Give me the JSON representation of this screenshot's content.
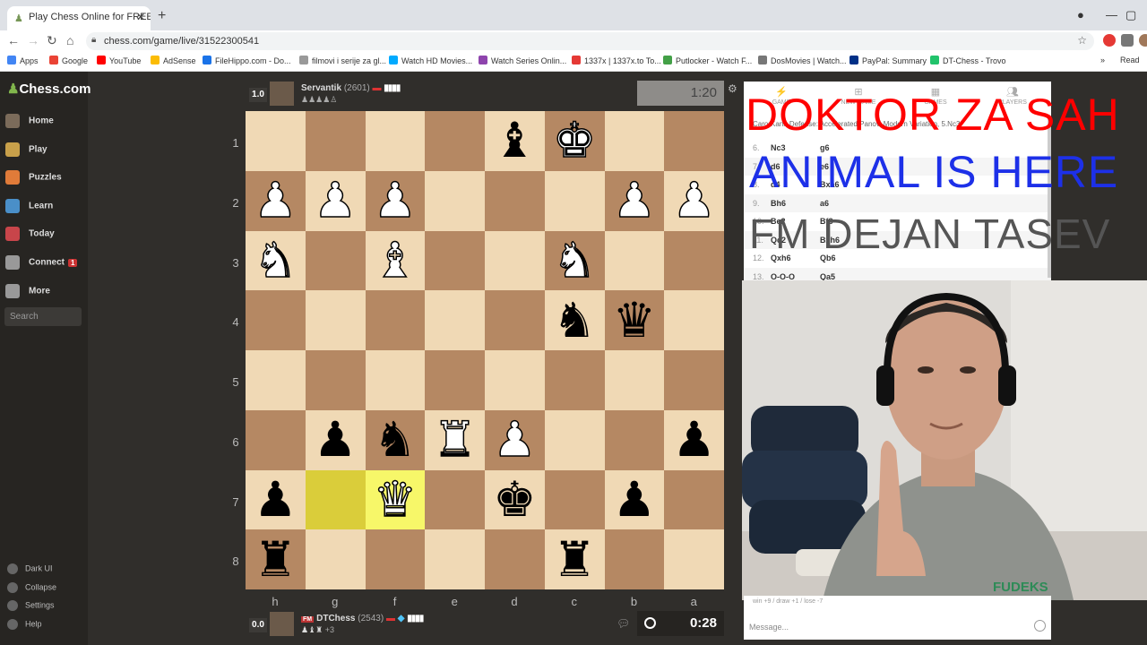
{
  "browser": {
    "tab_title": "Play Chess Online for FREE with F",
    "url": "chess.com/game/live/31522300541",
    "bookmarks": [
      {
        "label": "Apps",
        "color": "#4285f4"
      },
      {
        "label": "Google",
        "color": "#ea4335"
      },
      {
        "label": "YouTube",
        "color": "#ff0000"
      },
      {
        "label": "AdSense",
        "color": "#fbbc05"
      },
      {
        "label": "FileHippo.com - Do...",
        "color": "#1a73e8"
      },
      {
        "label": "filmovi i serije za gl...",
        "color": "#999999"
      },
      {
        "label": "Watch HD Movies...",
        "color": "#00aaff"
      },
      {
        "label": "Watch Series Onlin...",
        "color": "#8e44ad"
      },
      {
        "label": "1337x | 1337x.to To...",
        "color": "#e53935"
      },
      {
        "label": "Putlocker - Watch F...",
        "color": "#43a047"
      },
      {
        "label": "DosMovies | Watch...",
        "color": "#777777"
      },
      {
        "label": "PayPal: Summary",
        "color": "#003087"
      },
      {
        "label": "DT-Chess - Trovo",
        "color": "#21c36b"
      }
    ],
    "reading_list": "Read"
  },
  "sidebar": {
    "logo": "Chess.com",
    "items": [
      {
        "label": "Home",
        "color": "#7b6b5a"
      },
      {
        "label": "Play",
        "color": "#c8a04a"
      },
      {
        "label": "Puzzles",
        "color": "#e07b39"
      },
      {
        "label": "Learn",
        "color": "#4a8fc8"
      },
      {
        "label": "Today",
        "color": "#c8454a"
      },
      {
        "label": "Connect",
        "color": "#999999",
        "badge": "1"
      },
      {
        "label": "More",
        "color": "#999999"
      }
    ],
    "search_placeholder": "Search",
    "bottom": [
      "Dark UI",
      "Collapse",
      "Settings",
      "Help"
    ]
  },
  "top_player": {
    "score": "1.0",
    "name": "Servantik",
    "rating": "(2601)",
    "captured": "♟♟♟♟♙",
    "clock": "1:20"
  },
  "bottom_player": {
    "score": "0.0",
    "title": "FM",
    "name": "DTChess",
    "rating": "(2543)",
    "captured": "♟♝♜",
    "advantage": "+3",
    "clock": "0:28"
  },
  "board": {
    "ranks": [
      "1",
      "2",
      "3",
      "4",
      "5",
      "6",
      "7",
      "8"
    ],
    "files": [
      "h",
      "g",
      "f",
      "e",
      "d",
      "c",
      "b",
      "a"
    ],
    "position": [
      [
        "",
        "",
        "",
        "",
        "b-bishop",
        "w-king",
        "",
        ""
      ],
      [
        "w-pawn",
        "w-pawn",
        "w-pawn",
        "",
        "",
        "",
        "w-pawn",
        "w-pawn"
      ],
      [
        "w-knight",
        "",
        "w-bishop",
        "",
        "",
        "w-knight",
        "",
        ""
      ],
      [
        "",
        "",
        "",
        "",
        "",
        "b-knight",
        "b-queen",
        ""
      ],
      [
        "",
        "",
        "",
        "",
        "",
        "",
        "",
        ""
      ],
      [
        "",
        "b-pawn",
        "b-knight",
        "w-rook",
        "w-pawn",
        "",
        "",
        "b-pawn"
      ],
      [
        "b-pawn",
        "",
        "w-queen",
        "",
        "b-king",
        "",
        "b-pawn",
        ""
      ],
      [
        "b-rook",
        "",
        "",
        "",
        "",
        "b-rook",
        "",
        ""
      ]
    ],
    "highlights": [
      [
        6,
        1
      ],
      [
        6,
        2
      ]
    ]
  },
  "panel": {
    "tabs": [
      "GAME",
      "NEW GAME",
      "GAMES",
      "PLAYERS"
    ],
    "opening": "Caro-Kann Defense: Accelerated Panov, Modern Variation, 5.Nc3",
    "moves": [
      {
        "n": "6.",
        "w": "Nc3",
        "b": "g6"
      },
      {
        "n": "7.",
        "w": "d6",
        "b": "e6"
      },
      {
        "n": "8.",
        "w": "d4",
        "b": "Bxa6"
      },
      {
        "n": "9.",
        "w": "Bh6",
        "b": "a6"
      },
      {
        "n": "10.",
        "w": "Be2",
        "b": "Bf8"
      },
      {
        "n": "11.",
        "w": "Qc2",
        "b": "Bxh6"
      },
      {
        "n": "12.",
        "w": "Qxh6",
        "b": "Qb6"
      },
      {
        "n": "13.",
        "w": "O-O-O",
        "b": "Qa5"
      }
    ],
    "chat_log": "win +9 / draw +1 / lose -7",
    "chat_placeholder": "Message..."
  },
  "overlay": {
    "line1": "DOKTOR ZA SAH",
    "line2": "ANIMAL IS HERE",
    "line3": "FM DEJAN TASEV"
  },
  "webcam": {
    "shirt_text": "FUDEKS"
  }
}
